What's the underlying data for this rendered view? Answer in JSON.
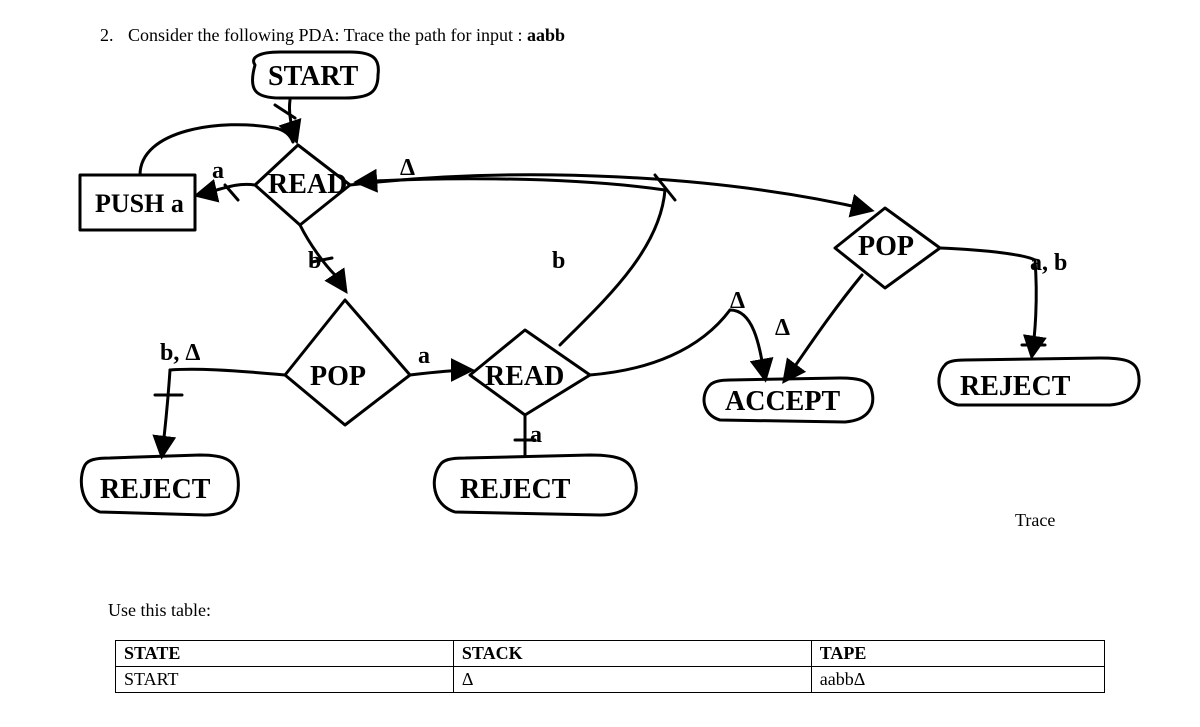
{
  "question": {
    "number": "2.",
    "prompt_prefix": "Consider the following PDA: Trace the path for input : ",
    "input": "aabb"
  },
  "nodes": {
    "start": "START",
    "read1": "READ",
    "push_a": "PUSH a",
    "pop1": "POP",
    "read2": "READ",
    "reject_left": "REJECT",
    "reject_mid": "REJECT",
    "accept": "ACCEPT",
    "pop2": "POP",
    "reject_right": "REJECT"
  },
  "edges": {
    "read1_to_push": "a",
    "read1_to_pop2": "Δ",
    "read1_to_pop1": "b",
    "pop1_to_reject_left": "b, Δ",
    "pop1_to_read2": "a",
    "read2_to_read1": "b",
    "read2_to_reject_mid": "a",
    "read2_to_accept": "Δ",
    "pop2_to_accept": "Δ",
    "pop2_to_reject_right": "a, b"
  },
  "trace_label": "Trace",
  "use_table_label": "Use this table:",
  "table": {
    "headers": [
      "STATE",
      "STACK",
      "TAPE"
    ],
    "rows": [
      [
        "START",
        "Δ",
        "aabbΔ"
      ]
    ]
  }
}
